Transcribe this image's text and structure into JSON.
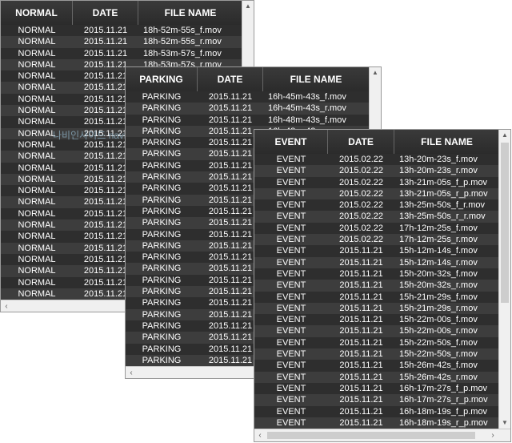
{
  "normal": {
    "headers": [
      "NORMAL",
      "DATE",
      "FILE NAME"
    ],
    "rows": [
      [
        "NORMAL",
        "2015.11.21",
        "18h-52m-55s_f.mov"
      ],
      [
        "NORMAL",
        "2015.11.21",
        "18h-52m-55s_r.mov"
      ],
      [
        "NORMAL",
        "2015.11.21",
        "18h-53m-57s_f.mov"
      ],
      [
        "NORMAL",
        "2015.11.21",
        "18h-53m-57s_r.mov"
      ],
      [
        "NORMAL",
        "2015.11.21",
        ""
      ],
      [
        "NORMAL",
        "2015.11.21",
        ""
      ],
      [
        "NORMAL",
        "2015.11.21",
        ""
      ],
      [
        "NORMAL",
        "2015.11.21",
        ""
      ],
      [
        "NORMAL",
        "2015.11.21",
        ""
      ],
      [
        "NORMAL",
        "2015.11.21",
        ""
      ],
      [
        "NORMAL",
        "2015.11.21",
        ""
      ],
      [
        "NORMAL",
        "2015.11.21",
        ""
      ],
      [
        "NORMAL",
        "2015.11.21",
        ""
      ],
      [
        "NORMAL",
        "2015.11.21",
        ""
      ],
      [
        "NORMAL",
        "2015.11.21",
        ""
      ],
      [
        "NORMAL",
        "2015.11.21",
        ""
      ],
      [
        "NORMAL",
        "2015.11.21",
        ""
      ],
      [
        "NORMAL",
        "2015.11.21",
        ""
      ],
      [
        "NORMAL",
        "2015.11.21",
        ""
      ],
      [
        "NORMAL",
        "2015.11.21",
        ""
      ],
      [
        "NORMAL",
        "2015.11.21",
        ""
      ],
      [
        "NORMAL",
        "2015.11.21",
        ""
      ],
      [
        "NORMAL",
        "2015.11.21",
        ""
      ],
      [
        "NORMAL",
        "2015.11.21",
        ""
      ]
    ]
  },
  "parking": {
    "headers": [
      "PARKING",
      "DATE",
      "FILE NAME"
    ],
    "rows": [
      [
        "PARKING",
        "2015.11.21",
        "16h-45m-43s_f.mov"
      ],
      [
        "PARKING",
        "2015.11.21",
        "16h-45m-43s_r.mov"
      ],
      [
        "PARKING",
        "2015.11.21",
        "16h-48m-43s_f.mov"
      ],
      [
        "PARKING",
        "2015.11.21",
        "16h-48m-43s_r.mov"
      ],
      [
        "PARKING",
        "2015.11.21",
        ""
      ],
      [
        "PARKING",
        "2015.11.21",
        ""
      ],
      [
        "PARKING",
        "2015.11.21",
        ""
      ],
      [
        "PARKING",
        "2015.11.21",
        ""
      ],
      [
        "PARKING",
        "2015.11.21",
        ""
      ],
      [
        "PARKING",
        "2015.11.21",
        ""
      ],
      [
        "PARKING",
        "2015.11.21",
        ""
      ],
      [
        "PARKING",
        "2015.11.21",
        ""
      ],
      [
        "PARKING",
        "2015.11.21",
        ""
      ],
      [
        "PARKING",
        "2015.11.21",
        ""
      ],
      [
        "PARKING",
        "2015.11.21",
        ""
      ],
      [
        "PARKING",
        "2015.11.21",
        ""
      ],
      [
        "PARKING",
        "2015.11.21",
        ""
      ],
      [
        "PARKING",
        "2015.11.21",
        ""
      ],
      [
        "PARKING",
        "2015.11.21",
        ""
      ],
      [
        "PARKING",
        "2015.11.21",
        ""
      ],
      [
        "PARKING",
        "2015.11.21",
        ""
      ],
      [
        "PARKING",
        "2015.11.21",
        ""
      ],
      [
        "PARKING",
        "2015.11.21",
        ""
      ],
      [
        "PARKING",
        "2015.11.21",
        ""
      ]
    ]
  },
  "event": {
    "headers": [
      "EVENT",
      "DATE",
      "FILE NAME"
    ],
    "rows": [
      [
        "EVENT",
        "2015.02.22",
        "13h-20m-23s_f.mov"
      ],
      [
        "EVENT",
        "2015.02.22",
        "13h-20m-23s_r.mov"
      ],
      [
        "EVENT",
        "2015.02.22",
        "13h-21m-05s_f_p.mov"
      ],
      [
        "EVENT",
        "2015.02.22",
        "13h-21m-05s_r_p.mov"
      ],
      [
        "EVENT",
        "2015.02.22",
        "13h-25m-50s_f_r.mov"
      ],
      [
        "EVENT",
        "2015.02.22",
        "13h-25m-50s_r_r.mov"
      ],
      [
        "EVENT",
        "2015.02.22",
        "17h-12m-25s_f.mov"
      ],
      [
        "EVENT",
        "2015.02.22",
        "17h-12m-25s_r.mov"
      ],
      [
        "EVENT",
        "2015.11.21",
        "15h-12m-14s_f.mov"
      ],
      [
        "EVENT",
        "2015.11.21",
        "15h-12m-14s_r.mov"
      ],
      [
        "EVENT",
        "2015.11.21",
        "15h-20m-32s_f.mov"
      ],
      [
        "EVENT",
        "2015.11.21",
        "15h-20m-32s_r.mov"
      ],
      [
        "EVENT",
        "2015.11.21",
        "15h-21m-29s_f.mov"
      ],
      [
        "EVENT",
        "2015.11.21",
        "15h-21m-29s_r.mov"
      ],
      [
        "EVENT",
        "2015.11.21",
        "15h-22m-00s_f.mov"
      ],
      [
        "EVENT",
        "2015.11.21",
        "15h-22m-00s_r.mov"
      ],
      [
        "EVENT",
        "2015.11.21",
        "15h-22m-50s_f.mov"
      ],
      [
        "EVENT",
        "2015.11.21",
        "15h-22m-50s_r.mov"
      ],
      [
        "EVENT",
        "2015.11.21",
        "15h-26m-42s_f.mov"
      ],
      [
        "EVENT",
        "2015.11.21",
        "15h-26m-42s_r.mov"
      ],
      [
        "EVENT",
        "2015.11.21",
        "16h-17m-27s_f_p.mov"
      ],
      [
        "EVENT",
        "2015.11.21",
        "16h-17m-27s_r_p.mov"
      ],
      [
        "EVENT",
        "2015.11.21",
        "16h-18m-19s_f_p.mov"
      ],
      [
        "EVENT",
        "2015.11.21",
        "16h-18m-19s_r_p.mov"
      ]
    ]
  },
  "watermark": {
    "blog": "나비인사이드 navinside.com"
  },
  "icons": {
    "up": "triangle-up",
    "down": "triangle-down",
    "left": "chevron-left",
    "right": "chevron-right"
  },
  "colors": {
    "row_odd": "#2e2e2e",
    "row_even": "#3d3d3d",
    "text": "#ffffff"
  }
}
